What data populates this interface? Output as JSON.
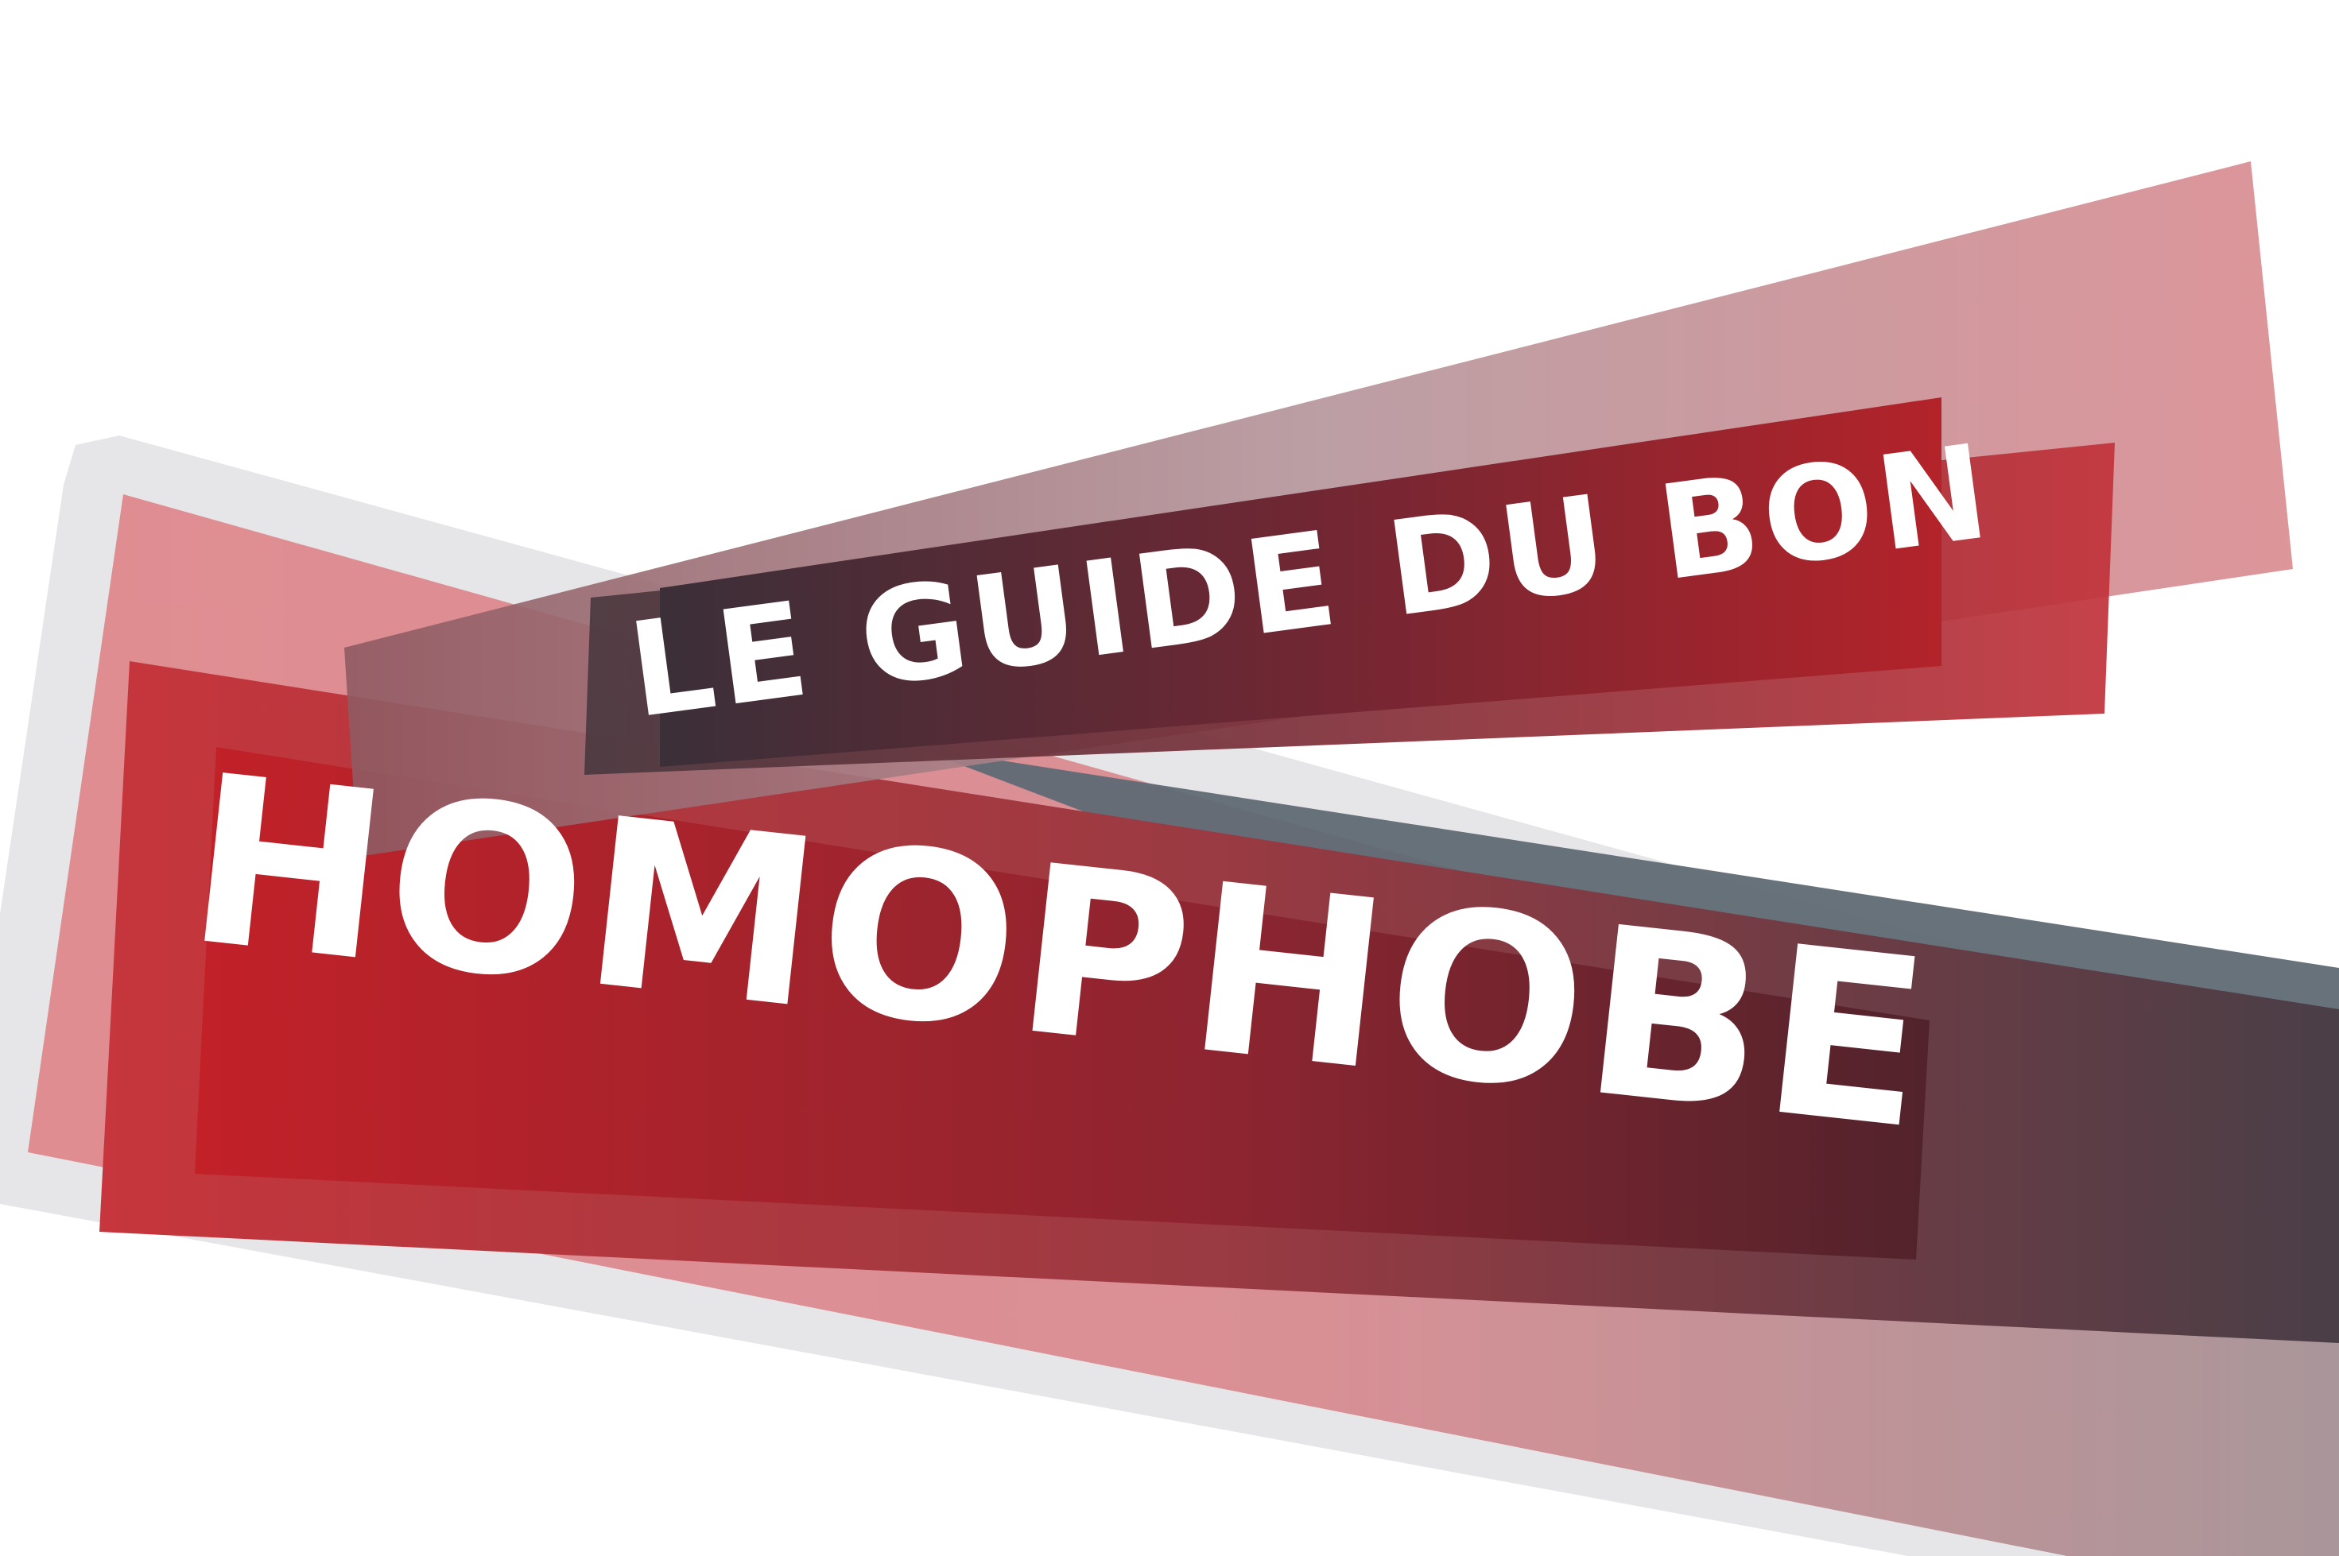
{
  "poster": {
    "kicker": "LE GUIDE DU BON",
    "headline": "HOMOPHOBE"
  },
  "colors": {
    "background": "#ffffff",
    "shadow_gray": "#e6e6e8",
    "brand_red": "#c22026",
    "dark_slate": "#3a3a45",
    "rose": "#e08a8f",
    "text": "#ffffff"
  }
}
